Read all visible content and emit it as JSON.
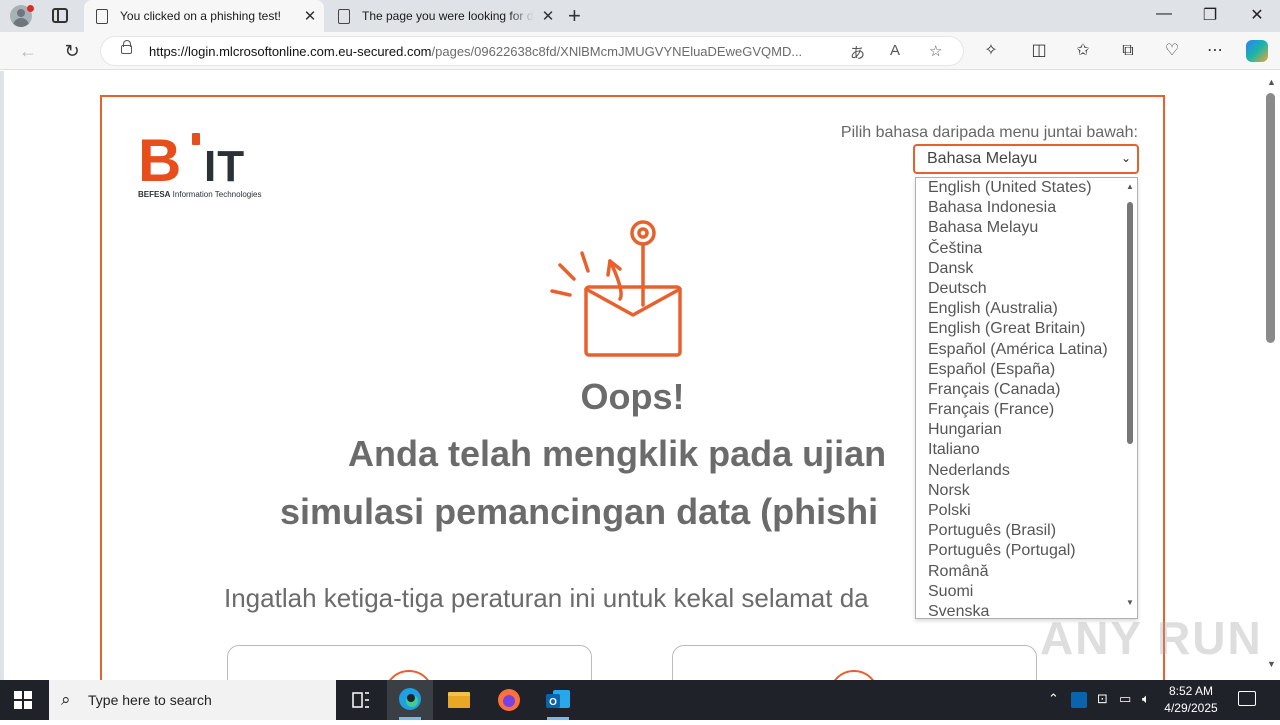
{
  "browser": {
    "tabs": [
      {
        "title": "You clicked on a phishing test!",
        "active": true
      },
      {
        "title": "The page you were looking for doesn't exist",
        "active": false
      }
    ],
    "url_host": "https://login.mlcrosoftonline.com.eu-secured.com",
    "url_path": "/pages/09622638c8fd/XNlBMcmJMUGVYNEluaDEweGVQMD..."
  },
  "page": {
    "logo": {
      "mark": "B",
      "it": "IT",
      "sub_bold": "BEFESA",
      "sub_rest": " Information Technologies"
    },
    "language_label": "Pilih bahasa daripada menu juntai bawah:",
    "language_selected": "Bahasa Melayu",
    "language_options": [
      "English (United States)",
      "Bahasa Indonesia",
      "Bahasa Melayu",
      "Čeština",
      "Dansk",
      "Deutsch",
      "English (Australia)",
      "English (Great Britain)",
      "Español (América Latina)",
      "Español (España)",
      "Français (Canada)",
      "Français (France)",
      "Hungarian",
      "Italiano",
      "Nederlands",
      "Norsk",
      "Polski",
      "Português (Brasil)",
      "Português (Portugal)",
      "Română",
      "Suomi",
      "Svenska"
    ],
    "oops": "Oops!",
    "headline_line1": "Anda telah mengklik pada ujian",
    "headline_line2": "simulasi pemancingan data (phishi",
    "rules_text": "Ingatlah ketiga-tiga peraturan ini untuk kekal selamat da"
  },
  "watermark": "ANY RUN",
  "taskbar": {
    "search_placeholder": "Type here to search",
    "time": "8:52 AM",
    "date": "4/29/2025"
  },
  "colors": {
    "accent": "#e8612c",
    "text_gray": "#6b6b6b",
    "taskbar": "#1f2329"
  }
}
